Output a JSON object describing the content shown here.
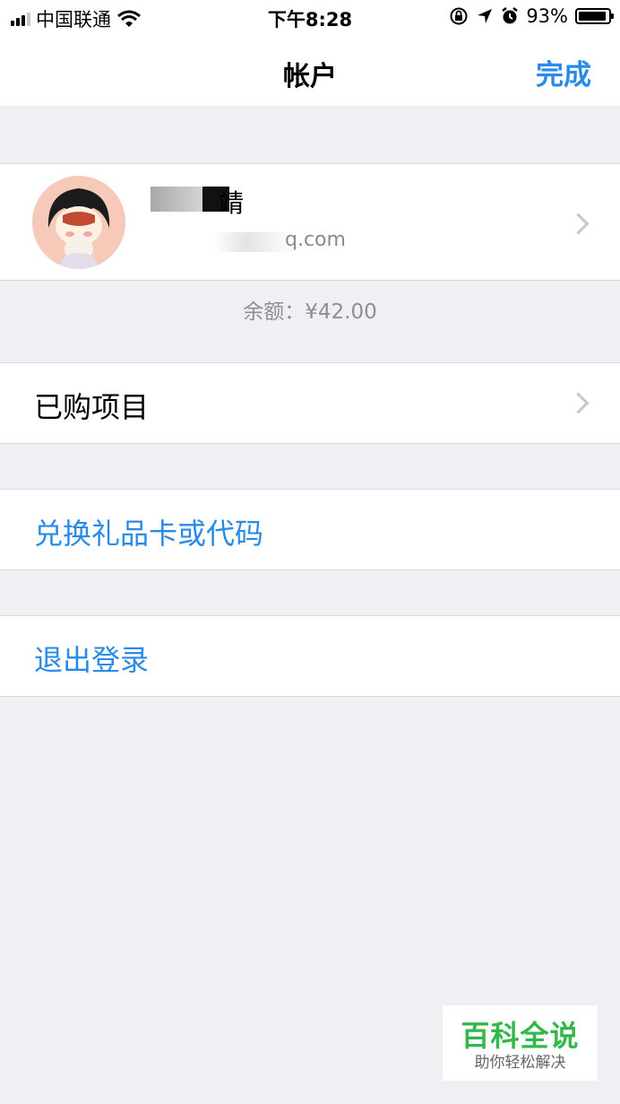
{
  "status_bar": {
    "carrier": "中国联通",
    "time": "下午8:28",
    "battery_percent": "93%",
    "battery_level": 0.93
  },
  "nav": {
    "title": "帐户",
    "done_label": "完成"
  },
  "profile": {
    "name_visible": "靖",
    "email_visible": "q.com"
  },
  "balance": "余额：¥42.00",
  "menu": {
    "purchased": "已购项目",
    "redeem": "兑换礼品卡或代码",
    "sign_out": "退出登录"
  },
  "watermark": {
    "title": "百科全说",
    "subtitle": "助你轻松解决"
  },
  "colors": {
    "accent": "#2a8ae8",
    "background": "#efeff4",
    "watermark_green": "#33b749"
  }
}
